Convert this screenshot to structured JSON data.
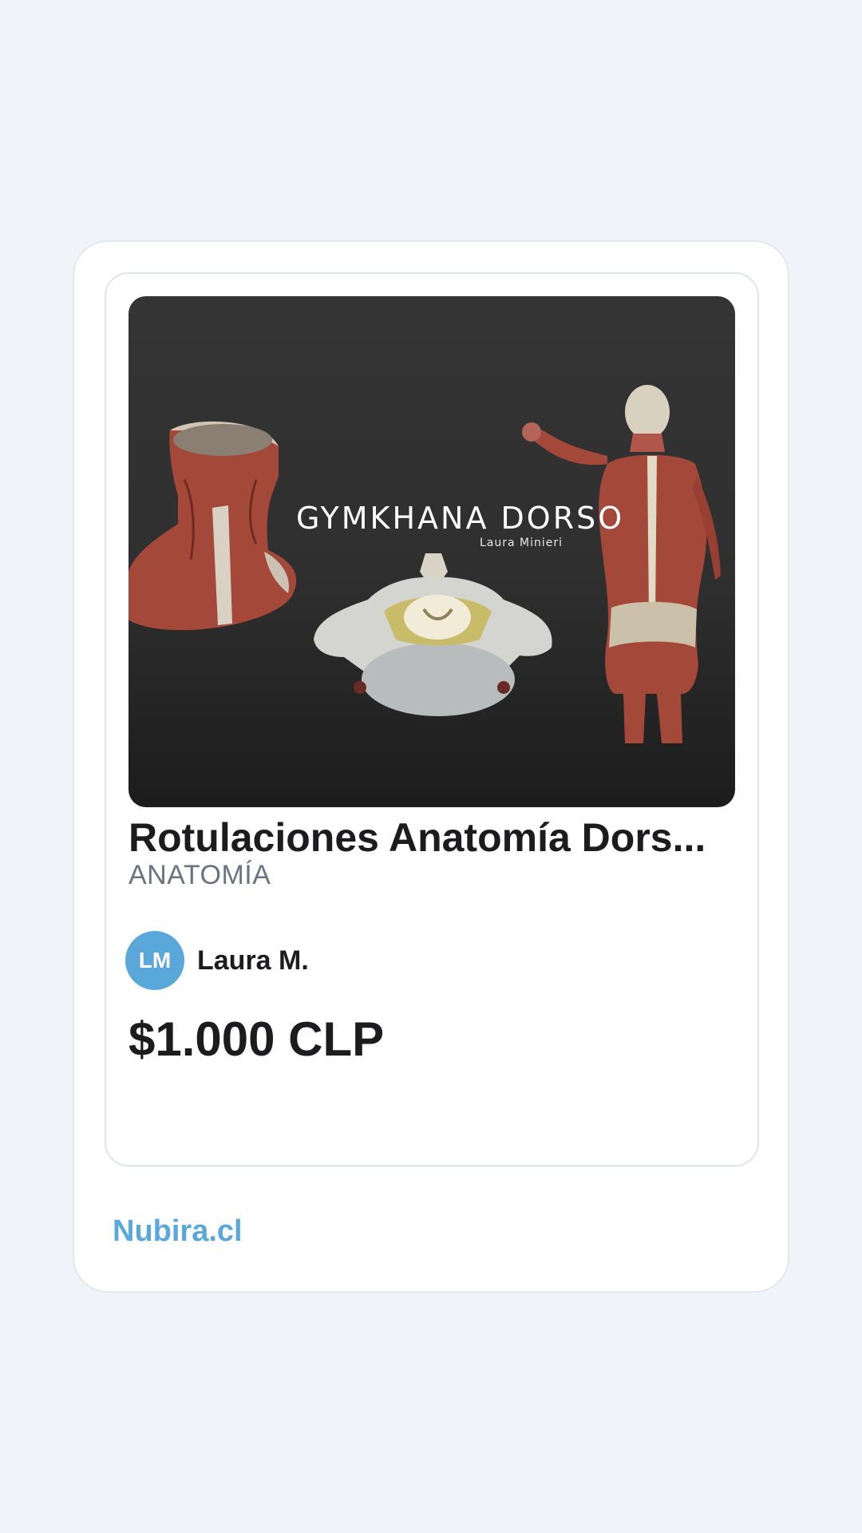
{
  "product": {
    "cover": {
      "title": "GYMKHANA DORSO",
      "author": "Laura Minieri"
    },
    "title": "Rotulaciones Anatomía Dors...",
    "category": "ANATOMÍA",
    "seller": {
      "initials": "LM",
      "name": "Laura M."
    },
    "price": "$1.000 CLP"
  },
  "footer": {
    "brand": "Nubira.cl"
  },
  "colors": {
    "accent": "#5aa8da",
    "background": "#f0f4f8",
    "text": "#1c1c1e",
    "muted": "#6b7280"
  }
}
